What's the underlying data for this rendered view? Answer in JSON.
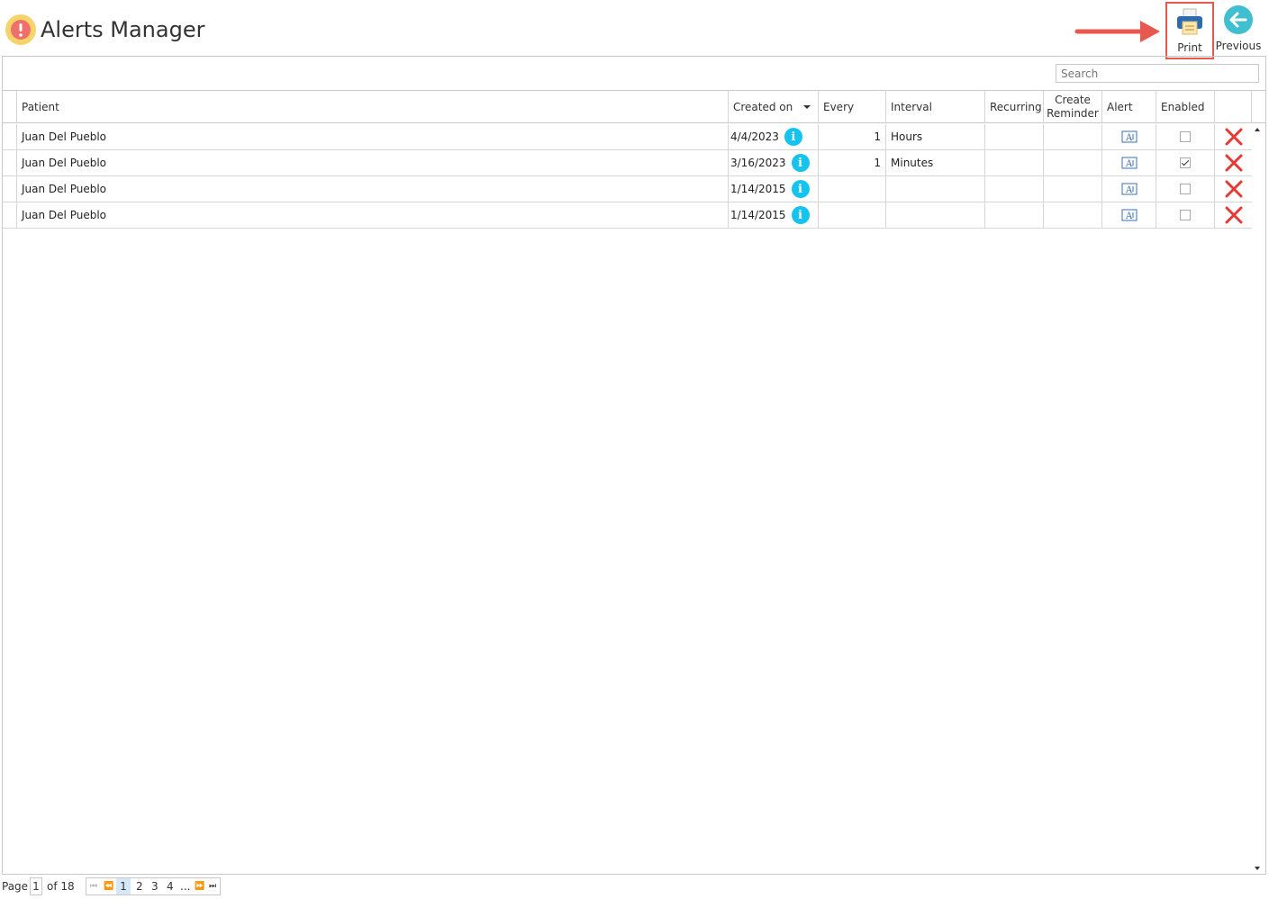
{
  "header": {
    "title": "Alerts Manager",
    "print_label": "Print",
    "previous_label": "Previous"
  },
  "search": {
    "placeholder": "Search"
  },
  "columns": {
    "patient": "Patient",
    "created_on": "Created on",
    "every": "Every",
    "interval": "Interval",
    "recurring": "Recurring",
    "create_reminder": "Create Reminder",
    "alert": "Alert",
    "enabled": "Enabled"
  },
  "rows": [
    {
      "patient": "Juan Del Pueblo",
      "created_on": "4/4/2023",
      "every": "1",
      "interval": "Hours",
      "recurring": "",
      "create_reminder": "",
      "enabled": false
    },
    {
      "patient": "Juan Del Pueblo",
      "created_on": "3/16/2023",
      "every": "1",
      "interval": "Minutes",
      "recurring": "",
      "create_reminder": "",
      "enabled": true
    },
    {
      "patient": "Juan Del Pueblo",
      "created_on": "1/14/2015",
      "every": "",
      "interval": "",
      "recurring": "",
      "create_reminder": "",
      "enabled": false
    },
    {
      "patient": "Juan Del Pueblo",
      "created_on": "1/14/2015",
      "every": "",
      "interval": "",
      "recurring": "",
      "create_reminder": "",
      "enabled": false
    }
  ],
  "pager": {
    "page_label": "Page",
    "current_page": "1",
    "of_label": "of 18",
    "pages": [
      "1",
      "2",
      "3",
      "4",
      "..."
    ]
  },
  "icons": {
    "app": "alert-circle-icon",
    "print": "printer-icon",
    "previous": "arrow-left-circle-icon",
    "info": "info-icon",
    "alert": "text-a-icon",
    "delete": "delete-x-icon"
  },
  "colors": {
    "accent_red": "#e8584f",
    "delete_red": "#e53935",
    "info_blue": "#14c4ee",
    "previous_teal": "#3fbfcf",
    "app_icon_orange": "#f4a83a"
  }
}
